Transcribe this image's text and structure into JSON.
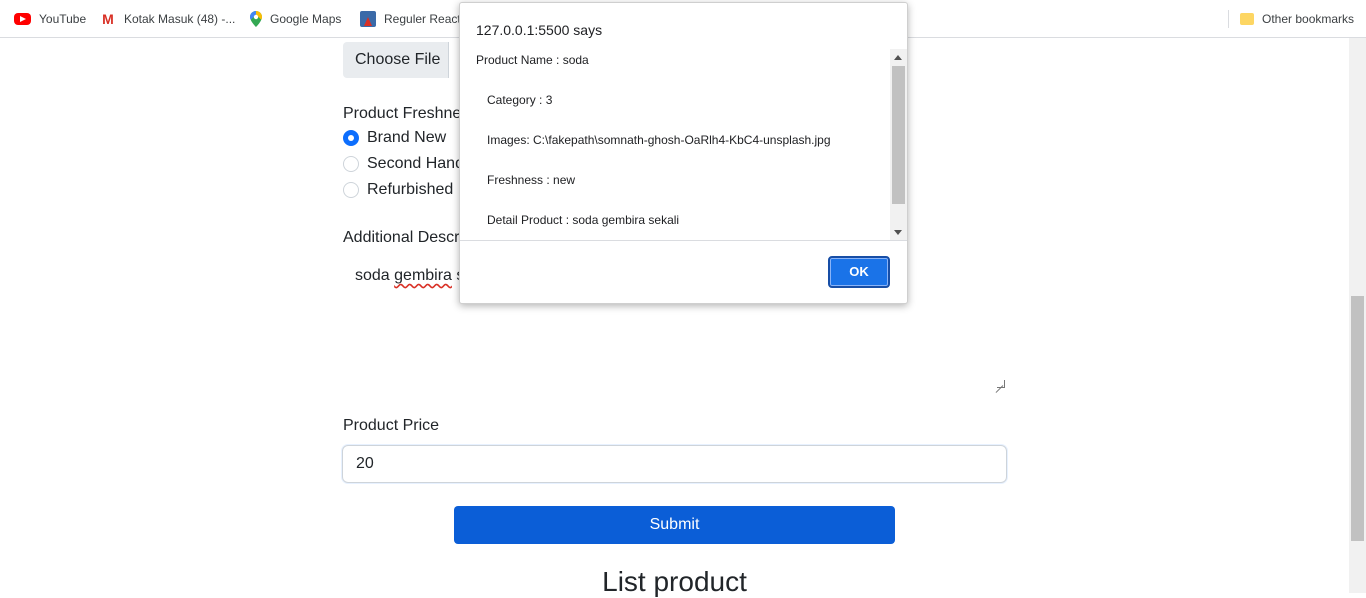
{
  "bookmarks": {
    "items": [
      {
        "label": "YouTube",
        "icon": "youtube-icon"
      },
      {
        "label": "Kotak Masuk (48) -...",
        "icon": "gmail-icon"
      },
      {
        "label": "Google Maps",
        "icon": "google-maps-icon"
      },
      {
        "label": "Reguler React",
        "icon": "bookmark-site-icon"
      }
    ],
    "other": {
      "label": "Other bookmarks",
      "icon": "folder-icon"
    }
  },
  "form": {
    "file_button": "Choose File",
    "freshness_label": "Product Freshne",
    "freshness_options": [
      {
        "label": "Brand New",
        "checked": true
      },
      {
        "label": "Second Hand",
        "checked": false
      },
      {
        "label": "Refurbished",
        "checked": false
      }
    ],
    "description_label": "Additional Descr",
    "description_value_a": "soda ",
    "description_value_b": "gembira",
    "description_value_c": " s",
    "price_label": "Product Price",
    "price_value": "20",
    "submit_label": "Submit"
  },
  "list": {
    "heading": "List product"
  },
  "dialog": {
    "title": "127.0.0.1:5500 says",
    "lines": [
      "Product Name : soda",
      "Category : 3",
      "Images: C:\\fakepath\\somnath-ghosh-OaRlh4-KbC4-unsplash.jpg",
      "Freshness : new",
      "Detail Product : soda gembira sekali"
    ],
    "ok_label": "OK"
  },
  "colors": {
    "primary": "#0b5ed7",
    "dialog_ok": "#1a73e8",
    "radio_checked": "#0d6efd"
  }
}
